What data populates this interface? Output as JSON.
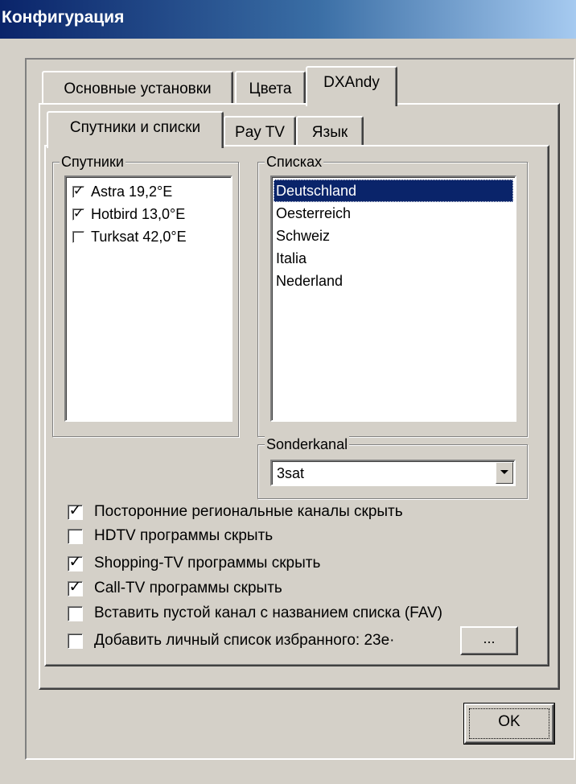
{
  "window": {
    "title": "Конфигурация"
  },
  "tabs_top": [
    {
      "label": "Основные установки",
      "active": false
    },
    {
      "label": "Цвета",
      "active": false
    },
    {
      "label": "DXAndy",
      "active": true
    }
  ],
  "tabs_inner": [
    {
      "label": "Спутники и списки",
      "active": true
    },
    {
      "label": "Pay TV",
      "active": false
    },
    {
      "label": "Язык",
      "active": false
    }
  ],
  "satellites": {
    "legend": "Спутники",
    "items": [
      {
        "label": "Astra 19,2°E",
        "checked": true
      },
      {
        "label": "Hotbird 13,0°E",
        "checked": true
      },
      {
        "label": "Turksat 42,0°E",
        "checked": false
      }
    ]
  },
  "lists": {
    "legend": "Списках",
    "items": [
      "Deutschland",
      "Oesterreich",
      "Schweiz",
      "Italia",
      "Nederland"
    ],
    "selected": "Deutschland"
  },
  "sonderkanal": {
    "legend": "Sonderkanal",
    "value": "3sat"
  },
  "options": [
    {
      "label": "Посторонние региональные каналы скрыть",
      "checked": true
    },
    {
      "label": "HDTV программы скрыть",
      "checked": false
    },
    {
      "label": "Shopping-TV программы скрыть",
      "checked": true
    },
    {
      "label": "Call-TV программы скрыть",
      "checked": true
    },
    {
      "label": "Вставить пустой канал с названием списка (FAV)",
      "checked": false
    },
    {
      "label": "Добавить личный список избранного: 23e·",
      "checked": false
    }
  ],
  "browse_button": "...",
  "ok_button": "OK",
  "colors": {
    "title_start": "#0a246a",
    "title_end": "#a6caf0",
    "face": "#d4d0c8",
    "selection": "#0a246a"
  },
  "icons": {
    "check": "check-mark-icon",
    "dropdown": "chevron-down-icon"
  }
}
